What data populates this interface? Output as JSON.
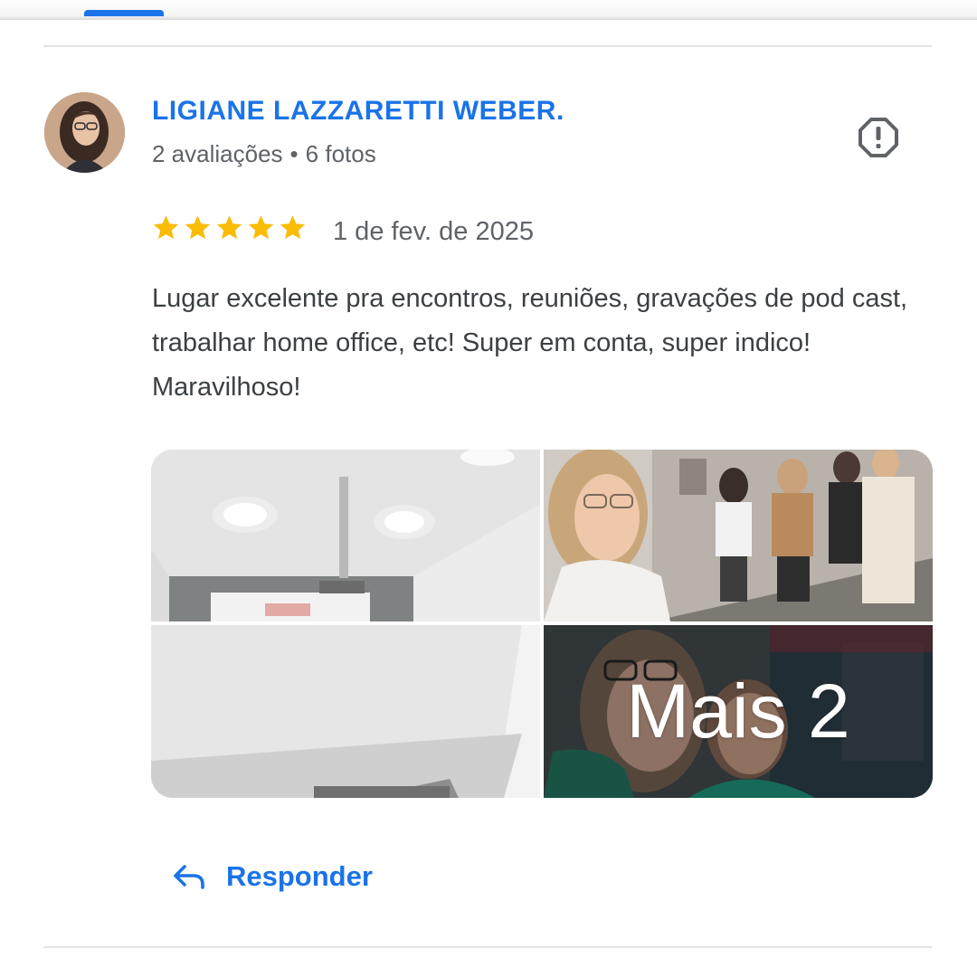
{
  "review": {
    "reviewer_name": "LIGIANE LAZZARETTI WEBER.",
    "reviews_count": "2 avaliações",
    "separator": "•",
    "photos_count": "6 fotos",
    "rating": 5,
    "date": "1 de fev. de 2025",
    "text": "Lugar excelente pra encontros, reuniões, gravações de pod cast, trabalhar home office, etc! Super em conta, super indico! Maravilhoso!",
    "photos": {
      "more_label": "Mais 2"
    },
    "reply_label": "Responder"
  },
  "icons": {
    "report": "report-flag-icon",
    "reply": "reply-arrow-icon",
    "star": "star-icon"
  },
  "colors": {
    "accent": "#1a73e8",
    "star": "#fbbc04",
    "text": "#3c4043",
    "secondary_text": "#5f6368"
  }
}
